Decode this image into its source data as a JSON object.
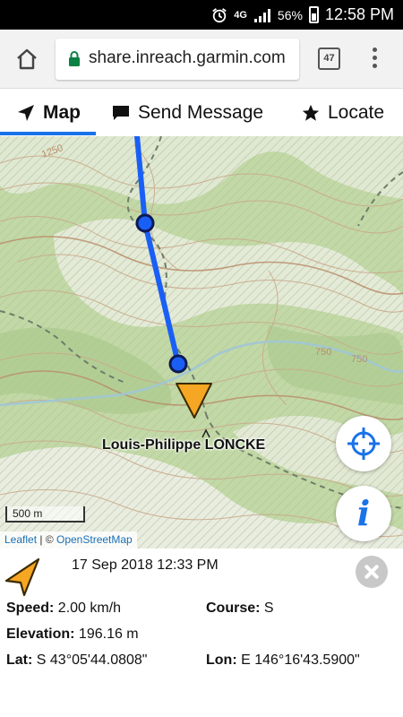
{
  "status_bar": {
    "network": "4G",
    "battery": "56%",
    "time": "12:58 PM"
  },
  "browser": {
    "url": "share.inreach.garmin.com",
    "tab_count": "47"
  },
  "tabs": [
    {
      "label": "Map",
      "icon": "navigation-arrow-icon"
    },
    {
      "label": "Send Message",
      "icon": "chat-bubble-icon"
    },
    {
      "label": "Locate",
      "icon": "star-icon"
    }
  ],
  "map": {
    "contour_labels": [
      "1250",
      "750",
      "750"
    ],
    "user_label": "Louis-Philippe LONCKE",
    "scale_label": "500 m",
    "attribution": {
      "leaflet": "Leaflet",
      "separator": " | © ",
      "osm": "OpenStreetMap"
    },
    "colors": {
      "track": "#1a5ff5",
      "marker": "#f5a623",
      "accent": "#1a73e8"
    }
  },
  "panel": {
    "datetime": "17 Sep 2018 12:33 PM",
    "speed": {
      "label": "Speed:",
      "value": "2.00 km/h"
    },
    "course": {
      "label": "Course:",
      "value": "S"
    },
    "elevation": {
      "label": "Elevation:",
      "value": "196.16 m"
    },
    "lat": {
      "label": "Lat:",
      "value": "S 43°05'44.0808\""
    },
    "lon": {
      "label": "Lon:",
      "value": "E 146°16'43.5900\""
    }
  }
}
